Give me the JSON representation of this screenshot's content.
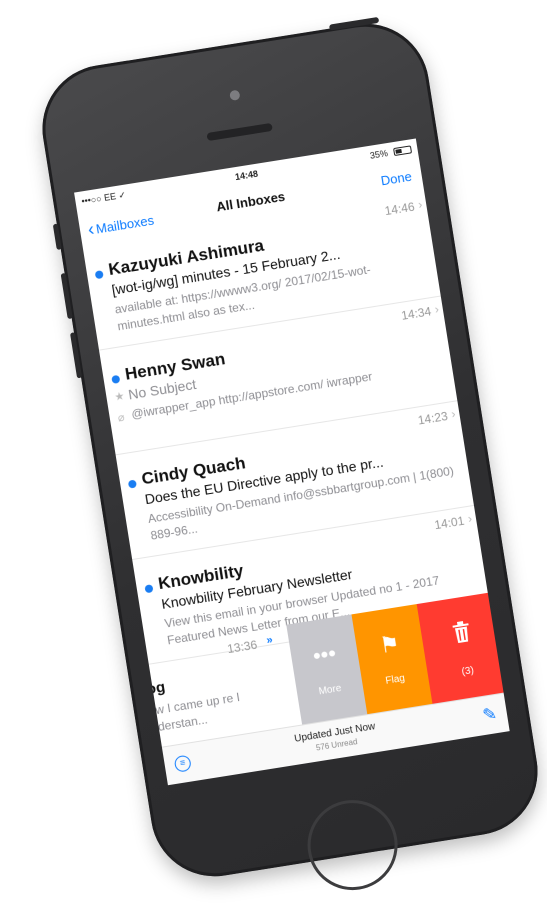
{
  "status_bar": {
    "carrier": "•••○○ EE ✓",
    "time": "14:48",
    "battery": "35%"
  },
  "nav": {
    "back_label": "Mailboxes",
    "title": "All Inboxes",
    "done_label": "Done"
  },
  "messages": [
    {
      "sender": "Kazuyuki Ashimura",
      "time": "14:46",
      "subject": "[wot-ig/wg] minutes - 15 February 2...",
      "preview": "available at: https://wwww3.org/ 2017/02/15-wot-minutes.html also as tex..."
    },
    {
      "sender": "Henny Swan",
      "time": "14:34",
      "subject": "No Subject",
      "preview": "@iwrapper_app http://appstore.com/ iwrapper"
    },
    {
      "sender": "Cindy Quach",
      "time": "14:23",
      "subject": "Does the EU Directive apply to the pr...",
      "preview": "Accessibility On-Demand info@ssbbartgroup.com | 1(800) 889-96..."
    },
    {
      "sender": "Knowbility",
      "time": "14:01",
      "subject": "Knowbility February Newsletter",
      "preview": "View this email in your browser Updated no 1 - 2017 Featured News Letter from our E..."
    }
  ],
  "swiped_message": {
    "time": "13:36",
    "sender": "log",
    "preview": "how I came up re I understan..."
  },
  "swipe_actions": {
    "more": "More",
    "flag": "Flag",
    "trash": "(3)"
  },
  "toolbar": {
    "updated": "Updated Just Now",
    "unread": "576 Unread"
  }
}
